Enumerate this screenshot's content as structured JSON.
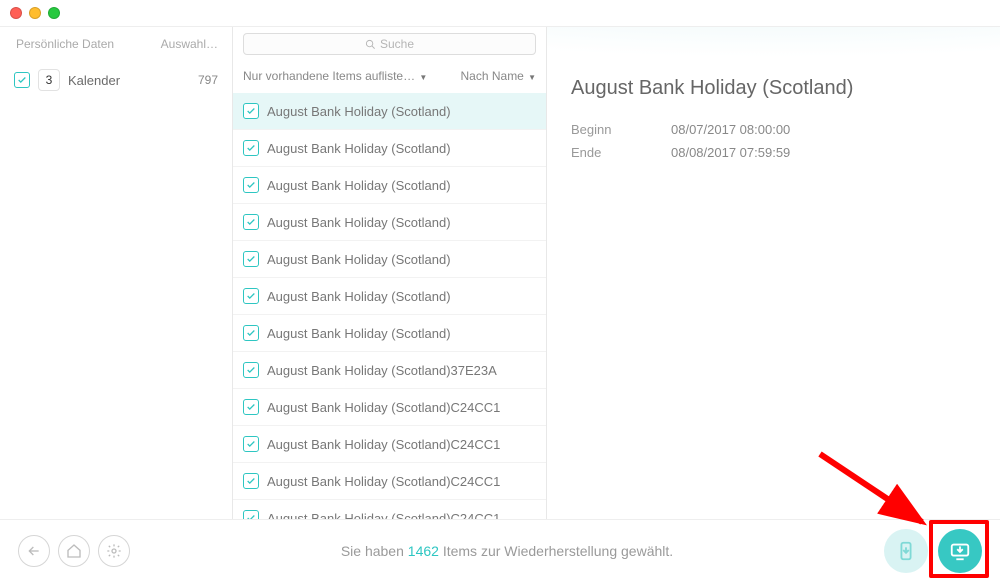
{
  "sidebar": {
    "header_left": "Persönliche Daten",
    "header_right": "Auswahl…",
    "items": [
      {
        "label": "Kalender",
        "count": "797"
      }
    ]
  },
  "search": {
    "placeholder": "Suche"
  },
  "filters": {
    "f1": "Nur vorhandene Items aufliste…",
    "f2": "Nach Name"
  },
  "events": [
    {
      "title": "August Bank Holiday (Scotland)",
      "selected": true
    },
    {
      "title": "August Bank Holiday (Scotland)"
    },
    {
      "title": "August Bank Holiday (Scotland)"
    },
    {
      "title": "August Bank Holiday (Scotland)"
    },
    {
      "title": "August Bank Holiday (Scotland)"
    },
    {
      "title": "August Bank Holiday (Scotland)"
    },
    {
      "title": "August Bank Holiday (Scotland)"
    },
    {
      "title": "August Bank Holiday (Scotland)37E23A"
    },
    {
      "title": "August Bank Holiday (Scotland)C24CC1"
    },
    {
      "title": "August Bank Holiday (Scotland)C24CC1"
    },
    {
      "title": "August Bank Holiday (Scotland)C24CC1"
    },
    {
      "title": "August Bank Holiday (Scotland)C24CC1"
    }
  ],
  "detail": {
    "title": "August Bank Holiday (Scotland)",
    "rows": [
      {
        "k": "Beginn",
        "v": "08/07/2017 08:00:00"
      },
      {
        "k": "Ende",
        "v": "08/08/2017 07:59:59"
      }
    ]
  },
  "footer": {
    "pre": "Sie haben ",
    "count": "1462",
    "post": " Items zur Wiederherstellung gewählt."
  },
  "colors": {
    "accent": "#2ec6c2",
    "highlight": "#ff0000"
  },
  "calendar_icon": {
    "day": "3"
  }
}
